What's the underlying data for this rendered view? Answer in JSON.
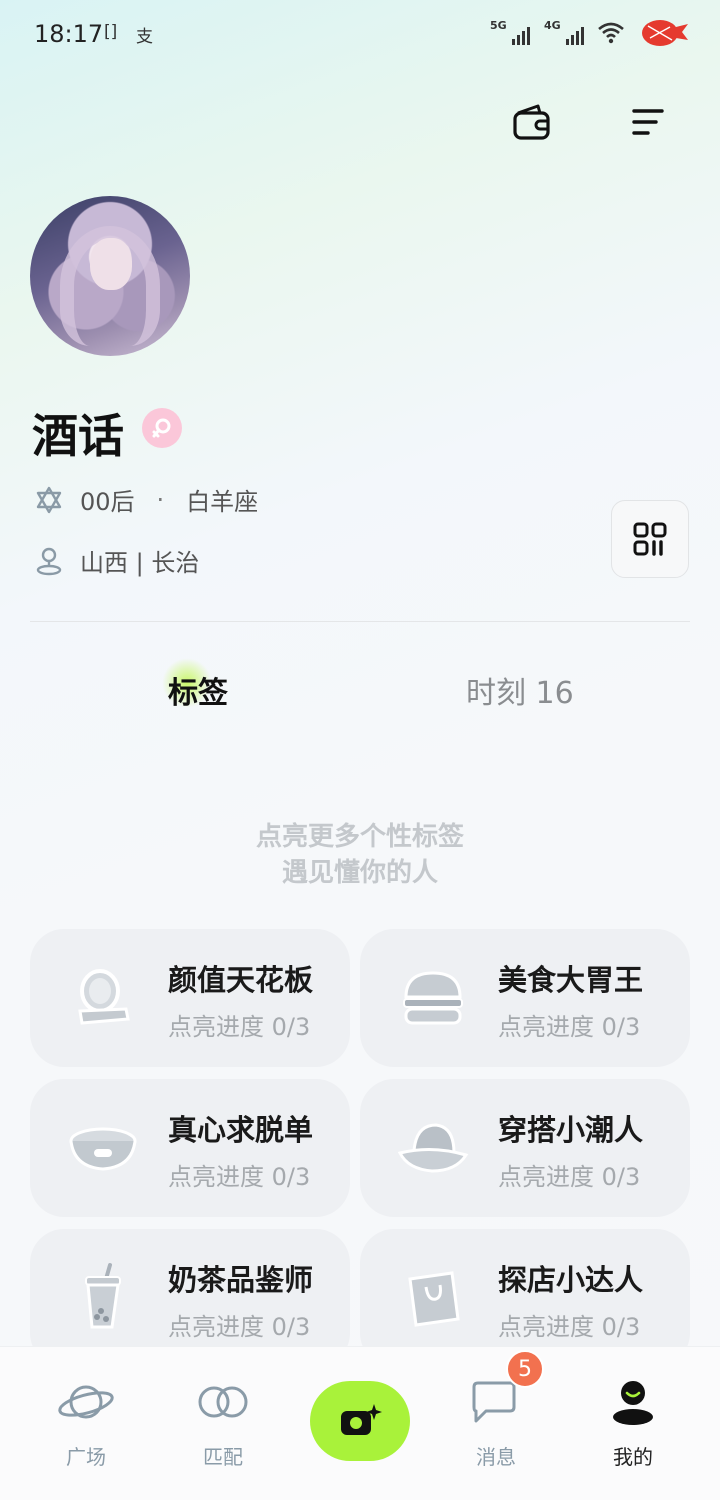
{
  "status_bar": {
    "time": "18:17",
    "app_icon_1": "[]",
    "app_icon_2": "支",
    "network_1": "5G",
    "network_2": "4G"
  },
  "profile": {
    "username": "酒话",
    "gender": "female",
    "generation": "00后",
    "separator": "·",
    "zodiac": "白羊座",
    "location": "山西 | 长治"
  },
  "tabs": [
    {
      "label": "标签",
      "active": true
    },
    {
      "label": "时刻 16",
      "active": false
    }
  ],
  "hint": {
    "line1": "点亮更多个性标签",
    "line2": "遇见懂你的人"
  },
  "tag_cards": [
    {
      "title": "颜值天花板",
      "progress": "点亮进度 0/3",
      "icon": "mirror-icon"
    },
    {
      "title": "美食大胃王",
      "progress": "点亮进度 0/3",
      "icon": "burger-icon"
    },
    {
      "title": "真心求脱单",
      "progress": "点亮进度 0/3",
      "icon": "pet-bowl-icon"
    },
    {
      "title": "穿搭小潮人",
      "progress": "点亮进度 0/3",
      "icon": "bucket-hat-icon"
    },
    {
      "title": "奶茶品鉴师",
      "progress": "点亮进度 0/3",
      "icon": "milk-tea-icon"
    },
    {
      "title": "探店小达人",
      "progress": "点亮进度 0/3",
      "icon": "shopping-bag-icon"
    }
  ],
  "bottom_nav": {
    "plaza": "广场",
    "match": "匹配",
    "messages": "消息",
    "messages_badge": "5",
    "mine": "我的"
  },
  "colors": {
    "accent": "#a9f23a",
    "badge": "#f2714f",
    "gender_badge": "#fbc7d9"
  }
}
